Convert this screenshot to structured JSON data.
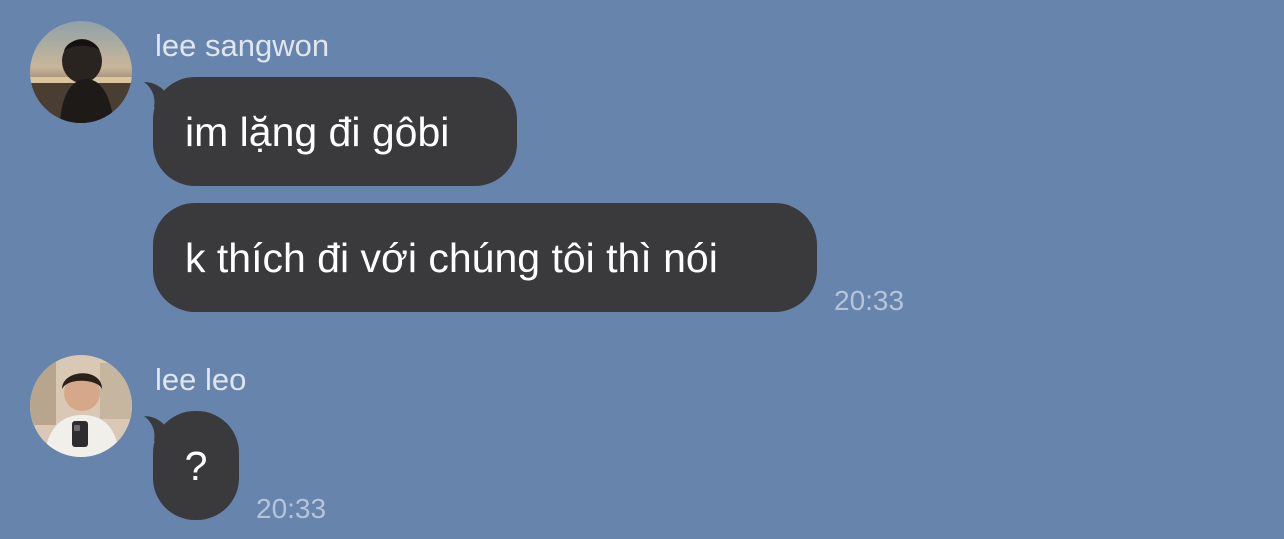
{
  "messages": [
    {
      "sender": "lee sangwon",
      "avatar": "profile-photo-sunset",
      "bubbles": [
        "im lặng đi gôbi",
        "k thích đi với chúng tôi thì nói"
      ],
      "time": "20:33"
    },
    {
      "sender": "lee leo",
      "avatar": "profile-photo-mirror-selfie",
      "bubbles": [
        "?"
      ],
      "time": "20:33"
    }
  ],
  "colors": {
    "background": "#6784ad",
    "bubble": "#3a3a3d",
    "bubble_text": "#ffffff",
    "sender_text": "#dfe6f0",
    "time_text": "#b5c4da"
  }
}
